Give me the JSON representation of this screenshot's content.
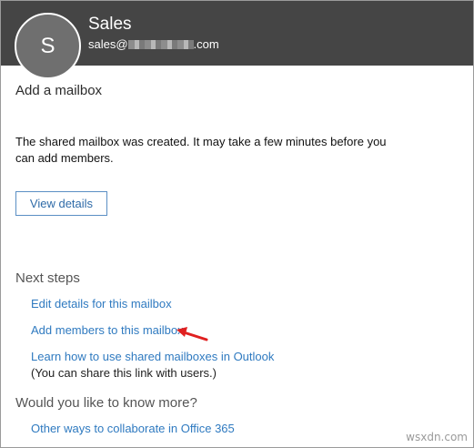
{
  "header": {
    "avatar_initial": "S",
    "title": "Sales",
    "email_prefix": "sales@",
    "email_suffix": ".com"
  },
  "page": {
    "heading": "Add a mailbox",
    "message": "The shared mailbox was created. It may take a few minutes before you can add members.",
    "view_details_label": "View details"
  },
  "next_steps": {
    "title": "Next steps",
    "links": [
      "Edit details for this mailbox",
      "Add members to this mailbox",
      "Learn how to use shared mailboxes in Outlook"
    ],
    "note": "(You can share this link with users.)"
  },
  "more": {
    "title": "Would you like to know more?",
    "link": "Other ways to collaborate in Office 365"
  },
  "watermark": "wsxdn.com",
  "colors": {
    "header_bg": "#454545",
    "avatar_bg": "#6f6f6f",
    "link": "#2f7ac0",
    "button_border": "#5b8fc4",
    "arrow": "#e02020"
  }
}
